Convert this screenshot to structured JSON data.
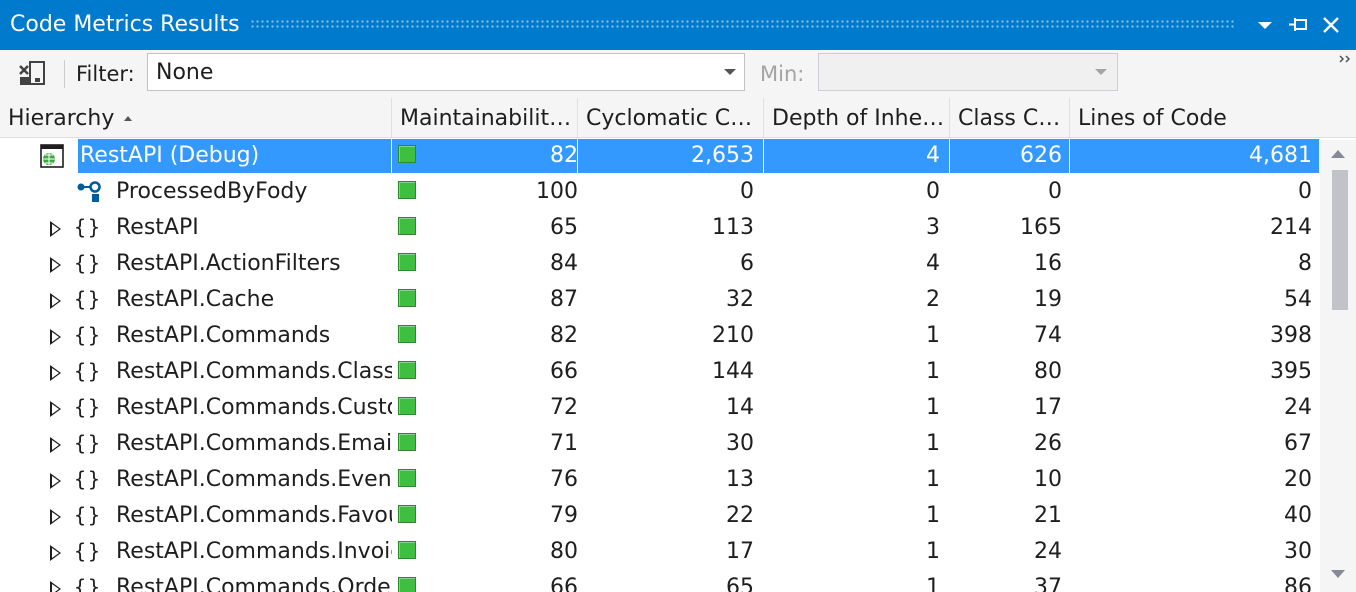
{
  "window": {
    "title": "Code Metrics Results"
  },
  "toolbar": {
    "filter_label": "Filter:",
    "filter_value": "None",
    "min_label": "Min:",
    "min_value": ""
  },
  "columns": [
    {
      "label": "Hierarchy",
      "sort": "ascending"
    },
    {
      "label": "Maintainability..."
    },
    {
      "label": "Cyclomatic Co..."
    },
    {
      "label": "Depth of Inher..."
    },
    {
      "label": "Class Co..."
    },
    {
      "label": "Lines of Code"
    }
  ],
  "rows": [
    {
      "name": "RestAPI (Debug)",
      "icon": "project-icon",
      "expander": "expanded",
      "selected": true,
      "mi": "82",
      "cc": "2,653",
      "doi": "4",
      "cco": "626",
      "loc": "4,681"
    },
    {
      "name": "ProcessedByFody",
      "icon": "type-icon",
      "expander": "none",
      "mi": "100",
      "cc": "0",
      "doi": "0",
      "cco": "0",
      "loc": "0"
    },
    {
      "name": "RestAPI",
      "icon": "namespace-icon",
      "expander": "collapsed",
      "mi": "65",
      "cc": "113",
      "doi": "3",
      "cco": "165",
      "loc": "214"
    },
    {
      "name": "RestAPI.ActionFilters",
      "icon": "namespace-icon",
      "expander": "collapsed",
      "mi": "84",
      "cc": "6",
      "doi": "4",
      "cco": "16",
      "loc": "8"
    },
    {
      "name": "RestAPI.Cache",
      "icon": "namespace-icon",
      "expander": "collapsed",
      "mi": "87",
      "cc": "32",
      "doi": "2",
      "cco": "19",
      "loc": "54"
    },
    {
      "name": "RestAPI.Commands",
      "icon": "namespace-icon",
      "expander": "collapsed",
      "mi": "82",
      "cc": "210",
      "doi": "1",
      "cco": "74",
      "loc": "398"
    },
    {
      "name": "RestAPI.Commands.Classif",
      "icon": "namespace-icon",
      "expander": "collapsed",
      "mi": "66",
      "cc": "144",
      "doi": "1",
      "cco": "80",
      "loc": "395"
    },
    {
      "name": "RestAPI.Commands.Custor",
      "icon": "namespace-icon",
      "expander": "collapsed",
      "mi": "72",
      "cc": "14",
      "doi": "1",
      "cco": "17",
      "loc": "24"
    },
    {
      "name": "RestAPI.Commands.Emails",
      "icon": "namespace-icon",
      "expander": "collapsed",
      "mi": "71",
      "cc": "30",
      "doi": "1",
      "cco": "26",
      "loc": "67"
    },
    {
      "name": "RestAPI.Commands.Events",
      "icon": "namespace-icon",
      "expander": "collapsed",
      "mi": "76",
      "cc": "13",
      "doi": "1",
      "cco": "10",
      "loc": "20"
    },
    {
      "name": "RestAPI.Commands.Favou",
      "icon": "namespace-icon",
      "expander": "collapsed",
      "mi": "79",
      "cc": "22",
      "doi": "1",
      "cco": "21",
      "loc": "40"
    },
    {
      "name": "RestAPI.Commands.Invoic",
      "icon": "namespace-icon",
      "expander": "collapsed",
      "mi": "80",
      "cc": "17",
      "doi": "1",
      "cco": "24",
      "loc": "30"
    },
    {
      "name": "RestAPI.Commands.Order",
      "icon": "namespace-icon",
      "expander": "collapsed",
      "mi": "66",
      "cc": "65",
      "doi": "1",
      "cco": "37",
      "loc": "86"
    }
  ],
  "colors": {
    "titlebar": "#007acc",
    "selection": "#3399ff",
    "maintainability_good": "#3fbf3f"
  }
}
